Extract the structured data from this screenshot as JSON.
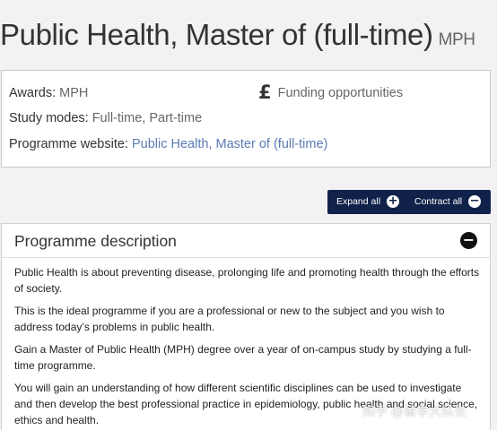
{
  "header": {
    "title": "Public Health, Master of (full-time)",
    "award_code": "MPH"
  },
  "info": {
    "awards_label": "Awards:",
    "awards_value": "MPH",
    "study_modes_label": "Study modes:",
    "study_modes_value": "Full-time, Part-time",
    "website_label": "Programme website:",
    "website_link": "Public Health, Master of (full-time)",
    "funding_icon": "£",
    "funding_label": "Funding opportunities"
  },
  "toolbar": {
    "expand_label": "Expand all",
    "expand_icon": "+",
    "contract_label": "Contract all",
    "contract_icon": "−"
  },
  "section": {
    "title": "Programme description",
    "collapse_icon": "−",
    "paragraphs": [
      "Public Health is about preventing disease, prolonging life and promoting health through the efforts of society.",
      "This is the ideal programme if you are a professional or new to the subject and you wish to address today’s problems in public health.",
      "Gain a Master of Public Health (MPH) degree over a year of on-campus study by studying a full-time programme.",
      "You will gain an understanding of how different scientific disciplines can be used to investigate and then develop the best professional practice in epidemiology, public health and social science, ethics and health."
    ]
  },
  "watermark": "知乎 @留学大队长",
  "colors": {
    "button_bar": "#10224a",
    "link": "#5b7bb4",
    "background": "#f2f2f2"
  }
}
